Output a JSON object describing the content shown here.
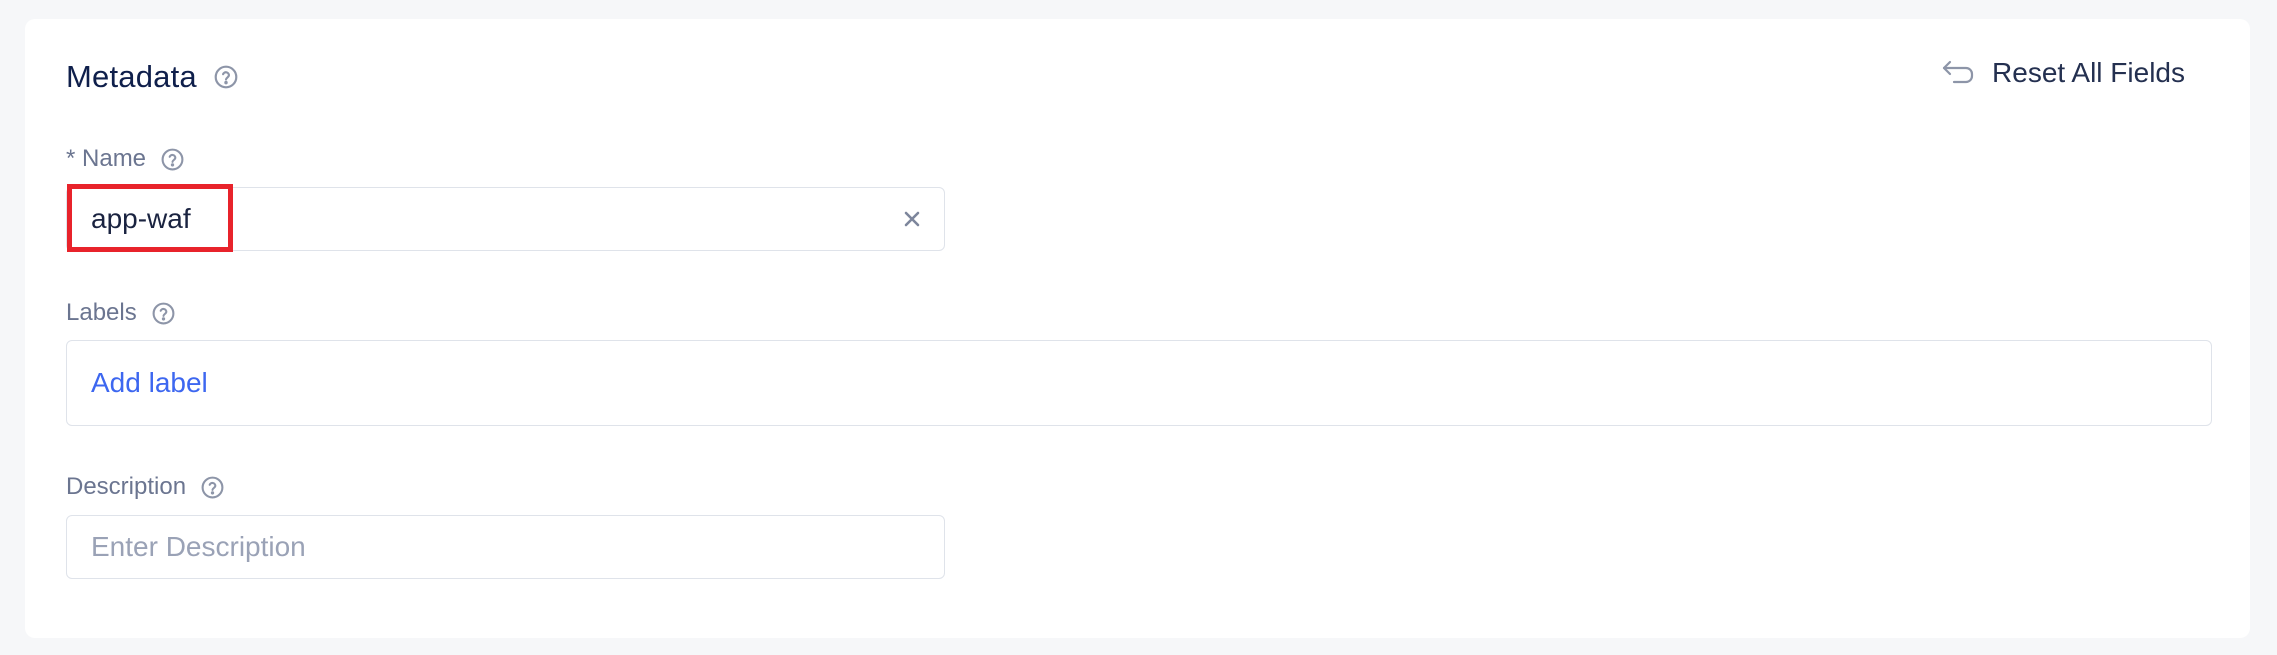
{
  "section": {
    "title": "Metadata",
    "help_icon": "question-circle-icon"
  },
  "reset": {
    "label": "Reset All Fields",
    "icon": "return-arrow-icon"
  },
  "fields": {
    "name": {
      "label": "* Name",
      "value": "app-waf",
      "clear_icon": "close-icon"
    },
    "labels": {
      "label": "Labels",
      "action": "Add label"
    },
    "description": {
      "label": "Description",
      "placeholder": "Enter Description"
    }
  },
  "colors": {
    "title": "#0f1f4b",
    "label": "#6b7590",
    "link": "#3d67f0",
    "border": "#dfe3ea",
    "highlight": "#e8232b",
    "background": "#f6f7f9"
  }
}
